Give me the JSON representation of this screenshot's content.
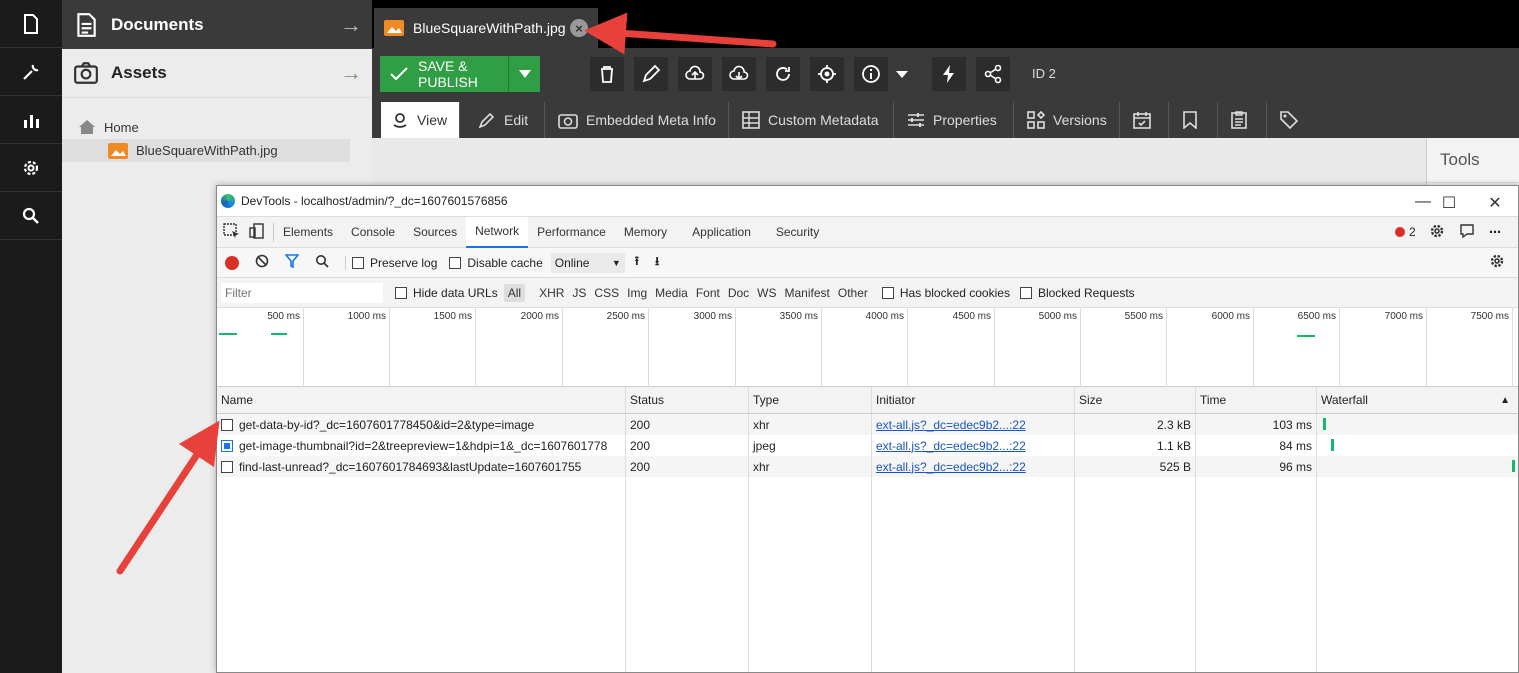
{
  "rail": {
    "items": [
      "documents-icon",
      "wrench-icon",
      "analytics-icon",
      "settings-icon",
      "search-icon"
    ]
  },
  "tree": {
    "documents_label": "Documents",
    "assets_label": "Assets",
    "home_label": "Home",
    "file_label": "BlueSquareWithPath.jpg"
  },
  "editor": {
    "tab_title": "BlueSquareWithPath.jpg",
    "save_label": "SAVE & PUBLISH",
    "id_label": "ID 2",
    "tabs": [
      "View",
      "Edit",
      "Embedded Meta Info",
      "Custom Metadata",
      "Properties",
      "Versions"
    ],
    "tools_label": "Tools"
  },
  "devtools": {
    "title": "DevTools - localhost/admin/?_dc=1607601576856",
    "panels": [
      "Elements",
      "Console",
      "Sources",
      "Network",
      "Performance",
      "Memory",
      "Application",
      "Security"
    ],
    "error_count": "2",
    "preserve_log": "Preserve log",
    "disable_cache": "Disable cache",
    "throttle": "Online",
    "filter_placeholder": "Filter",
    "hide_data_urls": "Hide data URLs",
    "filter_types": [
      "All",
      "XHR",
      "JS",
      "CSS",
      "Img",
      "Media",
      "Font",
      "Doc",
      "WS",
      "Manifest",
      "Other"
    ],
    "has_blocked_cookies": "Has blocked cookies",
    "blocked_requests": "Blocked Requests",
    "timeline_ticks": [
      "500 ms",
      "1000 ms",
      "1500 ms",
      "2000 ms",
      "2500 ms",
      "3000 ms",
      "3500 ms",
      "4000 ms",
      "4500 ms",
      "5000 ms",
      "5500 ms",
      "6000 ms",
      "6500 ms",
      "7000 ms",
      "7500 ms"
    ],
    "columns": [
      "Name",
      "Status",
      "Type",
      "Initiator",
      "Size",
      "Time",
      "Waterfall"
    ],
    "rows": [
      {
        "name": "get-data-by-id?_dc=1607601778450&id=2&type=image",
        "status": "200",
        "type": "xhr",
        "initiator": "ext-all.js?_dc=edec9b2...:22",
        "size": "2.3 kB",
        "time": "103 ms",
        "checked": false
      },
      {
        "name": "get-image-thumbnail?id=2&treepreview=1&hdpi=1&_dc=1607601778",
        "status": "200",
        "type": "jpeg",
        "initiator": "ext-all.js?_dc=edec9b2...:22",
        "size": "1.1 kB",
        "time": "84 ms",
        "checked": true
      },
      {
        "name": "find-last-unread?_dc=1607601784693&lastUpdate=1607601755",
        "status": "200",
        "type": "xhr",
        "initiator": "ext-all.js?_dc=edec9b2...:22",
        "size": "525 B",
        "time": "96 ms",
        "checked": false
      }
    ]
  },
  "colors": {
    "accent_green": "#2f9e44",
    "annotation_red": "#e8403a",
    "dark_panel": "#3a3a3a"
  }
}
